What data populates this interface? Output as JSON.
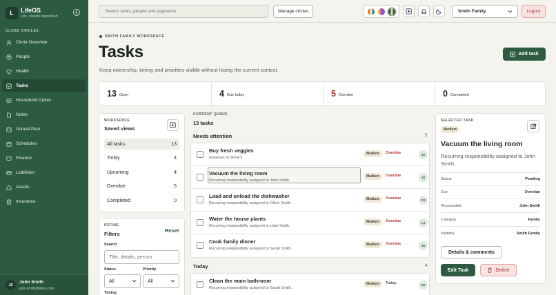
{
  "app": {
    "name": "LifeOS",
    "tagline": "Life, clearly organized",
    "logo_letter": "L"
  },
  "sidebar": {
    "section": "CLOSE CIRCLES",
    "items": [
      {
        "label": "Circle Overview",
        "icon": "circle-overview-icon"
      },
      {
        "label": "People",
        "icon": "people-icon"
      },
      {
        "label": "Health",
        "icon": "heart-icon"
      },
      {
        "label": "Tasks",
        "icon": "checkbox-icon",
        "active": true
      },
      {
        "label": "Household Duties",
        "icon": "broom-icon"
      },
      {
        "label": "Notes",
        "icon": "note-icon"
      },
      {
        "label": "Annual Plan",
        "icon": "calendar-icon"
      },
      {
        "label": "Schedules",
        "icon": "schedule-icon"
      },
      {
        "label": "Finance",
        "icon": "wallet-icon"
      },
      {
        "label": "Liabilities",
        "icon": "card-icon"
      },
      {
        "label": "Assets",
        "icon": "home-icon"
      },
      {
        "label": "Insurance",
        "icon": "shield-icon"
      }
    ],
    "user": {
      "initials": "JS",
      "name": "John Smith",
      "email": "john.smith@lifeos.com"
    }
  },
  "topbar": {
    "search_placeholder": "Search tasks, people and payments",
    "manage_circles": "Manage circles",
    "family_select": "Smith Family",
    "logout": "Logout"
  },
  "header": {
    "workspace": "SMITH FAMILY WORKSPACE",
    "title": "Tasks",
    "subtitle": "Keep ownership, timing and priorities visible without losing the current context.",
    "add_task": "Add task"
  },
  "stats": [
    {
      "value": "13",
      "label": "Open"
    },
    {
      "value": "4",
      "label": "Due today"
    },
    {
      "value": "5",
      "label": "Overdue",
      "color": "#b0332f"
    },
    {
      "value": "0",
      "label": "Completed"
    }
  ],
  "workspace_panel": {
    "caption": "WORKSPACE",
    "title": "Saved views",
    "views": [
      {
        "label": "All tasks",
        "count": "13"
      },
      {
        "label": "Today",
        "count": "4"
      },
      {
        "label": "Upcoming",
        "count": "4"
      },
      {
        "label": "Overdue",
        "count": "5"
      },
      {
        "label": "Completed",
        "count": "0"
      }
    ]
  },
  "refine_panel": {
    "caption": "REFINE",
    "title": "Filters",
    "reset": "Reset",
    "search_label": "Search",
    "search_placeholder": "Title, details, person",
    "status_label": "Status",
    "status_value": "All",
    "priority_label": "Priority",
    "priority_value": "All",
    "timing_label": "Timing"
  },
  "queue": {
    "caption": "CURRENT QUEUE",
    "count": "13 tasks",
    "groups": [
      {
        "title": "Needs attention",
        "count": "5",
        "tasks": [
          {
            "title": "Buy fresh veggies",
            "desc": "tomatoes at Steve's",
            "priority": "Medium",
            "due": "Overdue",
            "initials": "JS"
          },
          {
            "title": "Vacuum the living room",
            "desc": "Recurring responsibility assigned to John Smith.",
            "priority": "Medium",
            "due": "Overdue",
            "initials": "JS"
          },
          {
            "title": "Load and unload the dishwasher",
            "desc": "Recurring responsibility assigned to Oliver Smith.",
            "priority": "Medium",
            "due": "Overdue",
            "initials": "OS"
          },
          {
            "title": "Water the house plants",
            "desc": "Recurring responsibility assigned to Liam Smith.",
            "priority": "Medium",
            "due": "Overdue",
            "initials": "LS"
          },
          {
            "title": "Cook family dinner",
            "desc": "Recurring responsibility assigned to Sarah Smith.",
            "priority": "Medium",
            "due": "Overdue",
            "initials": "JS"
          }
        ]
      },
      {
        "title": "Today",
        "count": "4",
        "tasks": [
          {
            "title": "Clean the main bathroom",
            "desc": "Recurring responsibility assigned to Sarah Smith.",
            "priority": "Medium",
            "due": "Today",
            "initials": "SS"
          }
        ]
      }
    ]
  },
  "detail": {
    "caption": "SELECTED TASK",
    "priority": "Medium",
    "title": "Vacuum the living room",
    "desc": "Recurring responsibility assigned to John Smith.",
    "rows": [
      {
        "key": "Status",
        "value": "Pending"
      },
      {
        "key": "Due",
        "value": "Overdue"
      },
      {
        "key": "Responsible",
        "value": "John Smith"
      },
      {
        "key": "Category",
        "value": "Family"
      },
      {
        "key": "Visibility",
        "value": "Smith Family"
      }
    ],
    "details_btn": "Details & comments",
    "edit_btn": "Edit Task",
    "delete_btn": "Delete"
  },
  "colors": {
    "brand": "#2d5b42",
    "danger": "#b0332f",
    "background": "#f4f3ee"
  }
}
